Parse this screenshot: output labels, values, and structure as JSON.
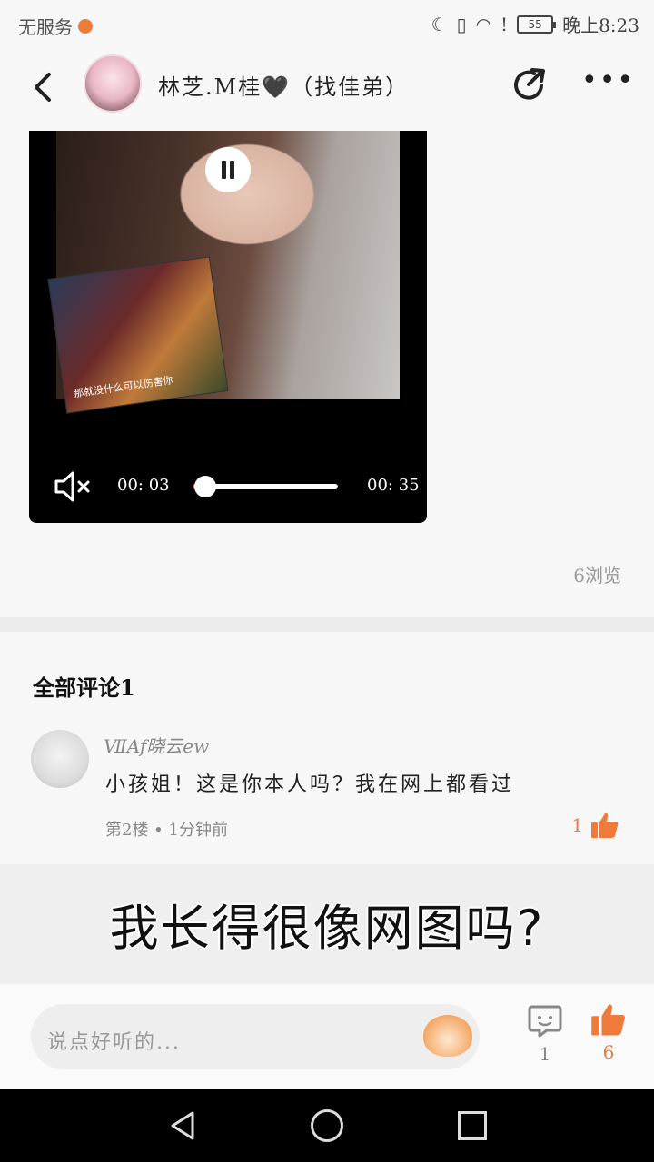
{
  "status_bar": {
    "carrier": "无服务",
    "battery": "55",
    "time": "晚上8:23"
  },
  "header": {
    "title": "林芝.M桂🖤（找佳弟）"
  },
  "video": {
    "current_time": "00: 03",
    "total_time": "00: 35",
    "progress": 0.086,
    "sticker_caption": "那就没什么可以伤害你"
  },
  "post": {
    "view_count": "6浏览"
  },
  "comments": {
    "title": "全部评论1",
    "items": [
      {
        "user": "ⅦAf晓云ew",
        "text": "小孩姐！这是你本人吗？我在网上都看过",
        "meta": "第2楼 • 1分钟前",
        "likes": "1"
      }
    ]
  },
  "overlay_caption": "我长得很像网图吗?",
  "bottom_bar": {
    "input_placeholder": "说点好听的...",
    "comment_count": "1",
    "like_count": "6"
  },
  "colors": {
    "accent": "#f07a3a"
  }
}
